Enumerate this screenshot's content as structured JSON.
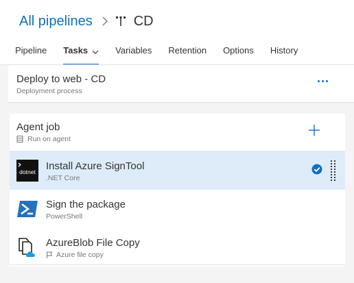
{
  "breadcrumb": {
    "root": "All pipelines",
    "current": "CD"
  },
  "tabs": [
    {
      "label": "Pipeline"
    },
    {
      "label": "Tasks"
    },
    {
      "label": "Variables"
    },
    {
      "label": "Retention"
    },
    {
      "label": "Options"
    },
    {
      "label": "History"
    }
  ],
  "process": {
    "title": "Deploy to web - CD",
    "subtitle": "Deployment process"
  },
  "agent_job": {
    "title": "Agent job",
    "subtitle": "Run on agent"
  },
  "tasks": [
    {
      "name": "Install Azure SignTool",
      "type": ".NET Core",
      "icon": "dotnet-icon",
      "icon_text": "dotnet",
      "selected": true
    },
    {
      "name": "Sign the package",
      "type": "PowerShell",
      "icon": "powershell-icon"
    },
    {
      "name": "AzureBlob File Copy",
      "type": "Azure file copy",
      "icon": "azure-file-copy-icon"
    }
  ],
  "colors": {
    "accent": "#106ebe",
    "selected_bg": "#deecf9",
    "page_bg": "#f4f4f4",
    "powershell": "#2671be",
    "azure": "#1e9be6"
  }
}
